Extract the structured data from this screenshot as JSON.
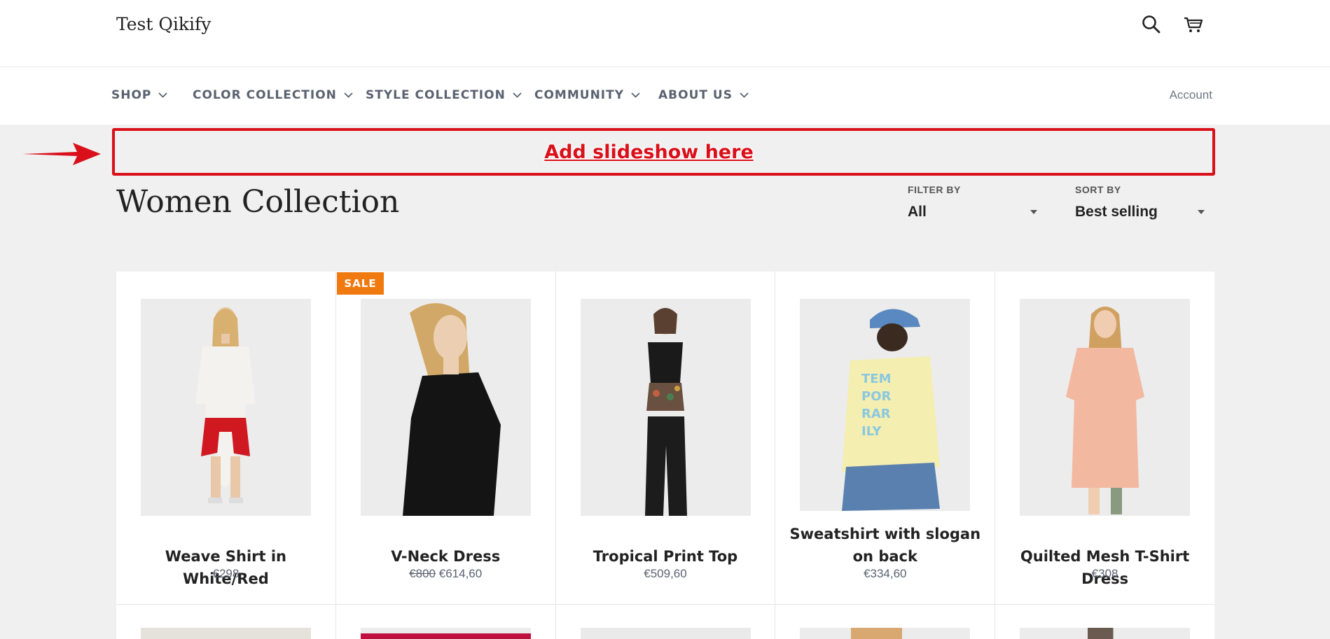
{
  "header": {
    "logo": "Test Qikify",
    "icons": [
      "search-icon",
      "cart-icon"
    ]
  },
  "nav": {
    "items": [
      {
        "label": "SHOP"
      },
      {
        "label": "COLOR COLLECTION"
      },
      {
        "label": "STYLE COLLECTION"
      },
      {
        "label": "COMMUNITY"
      },
      {
        "label": "ABOUT US"
      }
    ],
    "account": "Account"
  },
  "annotation": {
    "slideshow_text": "Add slideshow here",
    "color": "#d9101a"
  },
  "collection": {
    "title": "Women Collection",
    "filter": {
      "label": "FILTER BY",
      "value": "All"
    },
    "sort": {
      "label": "SORT BY",
      "value": "Best selling"
    }
  },
  "products": [
    {
      "title": "Weave Shirt in White/Red",
      "price": "€298"
    },
    {
      "title": "V-Neck Dress",
      "price_old": "€800",
      "price": "€614,60",
      "badge": "SALE"
    },
    {
      "title": "Tropical Print Top",
      "price": "€509,60"
    },
    {
      "title": "Sweatshirt with slogan on back",
      "price": "€334,60"
    },
    {
      "title": "Quilted Mesh T-Shirt Dress",
      "price": "€308"
    }
  ],
  "colors": {
    "sale_badge": "#f07a10",
    "nav_text": "#5a6270",
    "background": "#f0f0f0"
  }
}
